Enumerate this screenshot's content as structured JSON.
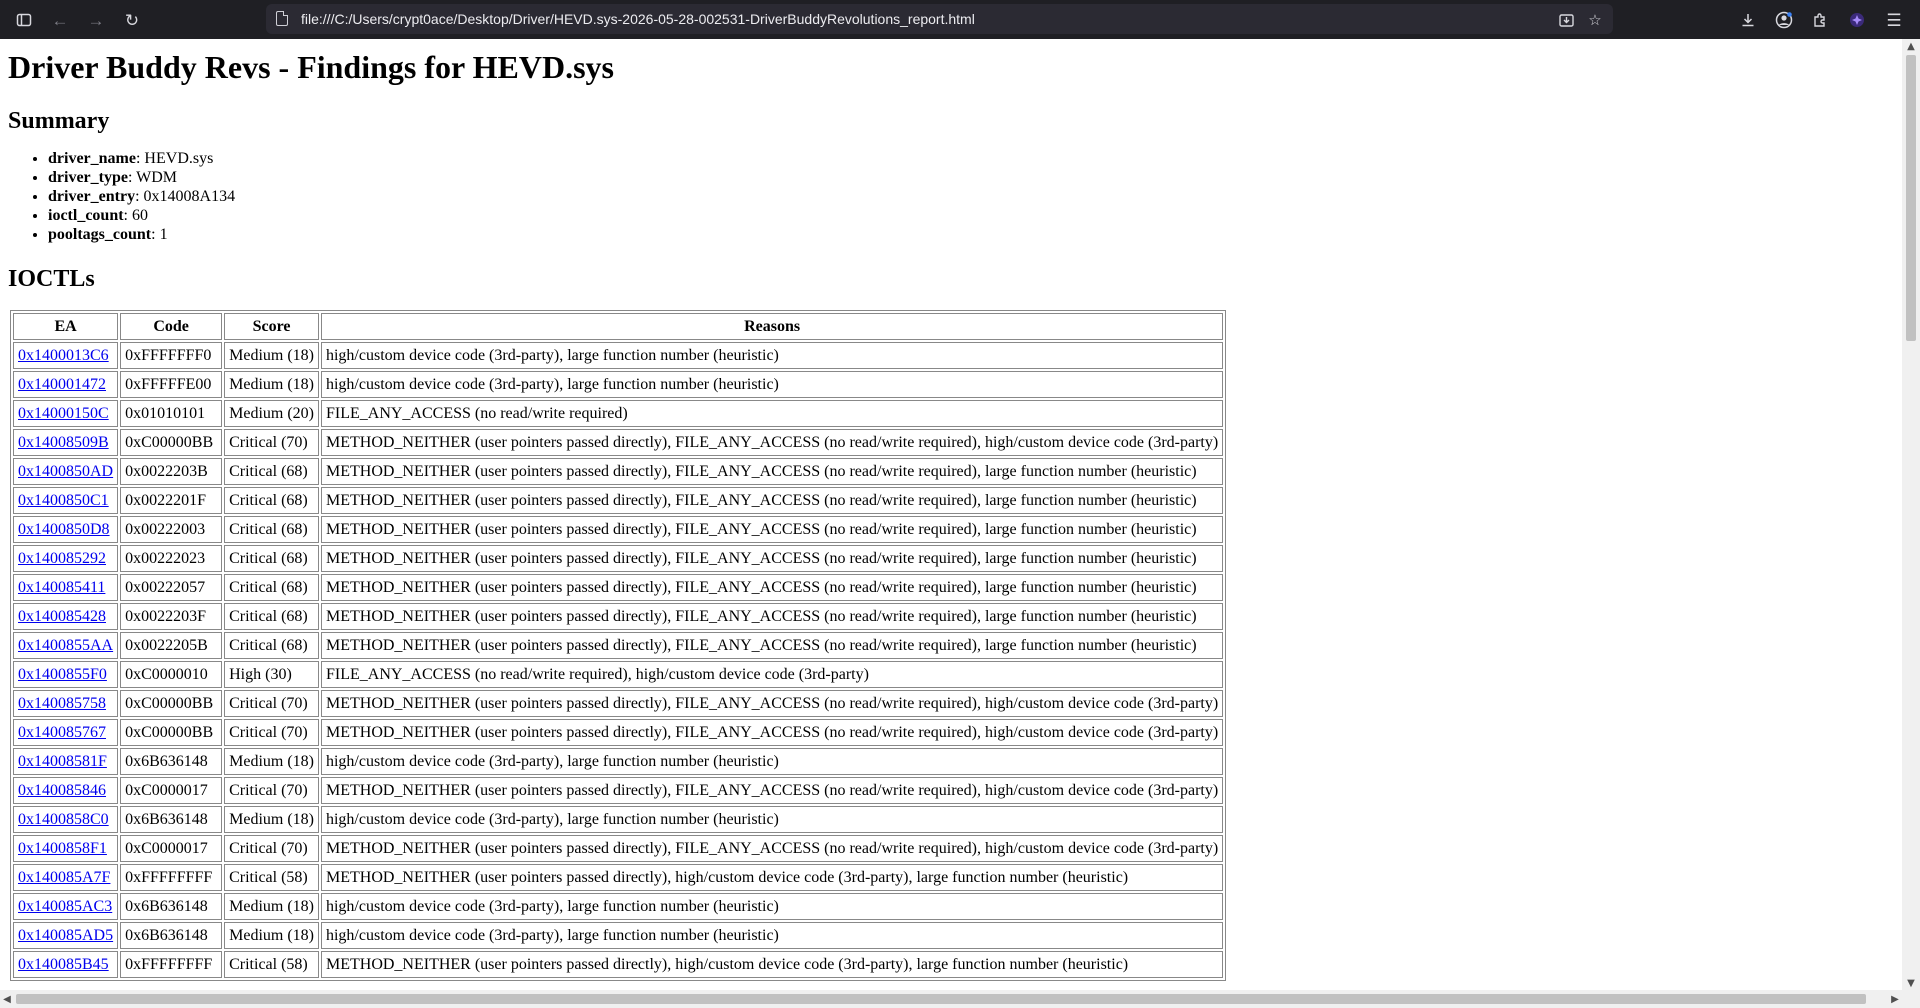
{
  "browser": {
    "url": "file:///C:/Users/crypt0ace/Desktop/Driver/HEVD.sys-2026-05-28-002531-DriverBuddyRevolutions_report.html"
  },
  "page": {
    "title": "Driver Buddy Revs - Findings for HEVD.sys",
    "summary_heading": "Summary",
    "summary": [
      {
        "key": "driver_name",
        "value": ": HEVD.sys"
      },
      {
        "key": "driver_type",
        "value": ": WDM"
      },
      {
        "key": "driver_entry",
        "value": ": 0x14008A134"
      },
      {
        "key": "ioctl_count",
        "value": ": 60"
      },
      {
        "key": "pooltags_count",
        "value": ": 1"
      }
    ],
    "ioctls_heading": "IOCTLs"
  },
  "table": {
    "headers": [
      "EA",
      "Code",
      "Score",
      "Reasons"
    ],
    "rows": [
      {
        "ea": "0x1400013C6",
        "code": "0xFFFFFFF0",
        "score": "Medium (18)",
        "reasons": "high/custom device code (3rd-party), large function number (heuristic)"
      },
      {
        "ea": "0x140001472",
        "code": "0xFFFFFE00",
        "score": "Medium (18)",
        "reasons": "high/custom device code (3rd-party), large function number (heuristic)"
      },
      {
        "ea": "0x14000150C",
        "code": "0x01010101",
        "score": "Medium (20)",
        "reasons": "FILE_ANY_ACCESS (no read/write required)"
      },
      {
        "ea": "0x14008509B",
        "code": "0xC00000BB",
        "score": "Critical (70)",
        "reasons": "METHOD_NEITHER (user pointers passed directly), FILE_ANY_ACCESS (no read/write required), high/custom device code (3rd-party)"
      },
      {
        "ea": "0x1400850AD",
        "code": "0x0022203B",
        "score": "Critical (68)",
        "reasons": "METHOD_NEITHER (user pointers passed directly), FILE_ANY_ACCESS (no read/write required), large function number (heuristic)"
      },
      {
        "ea": "0x1400850C1",
        "code": "0x0022201F",
        "score": "Critical (68)",
        "reasons": "METHOD_NEITHER (user pointers passed directly), FILE_ANY_ACCESS (no read/write required), large function number (heuristic)"
      },
      {
        "ea": "0x1400850D8",
        "code": "0x00222003",
        "score": "Critical (68)",
        "reasons": "METHOD_NEITHER (user pointers passed directly), FILE_ANY_ACCESS (no read/write required), large function number (heuristic)"
      },
      {
        "ea": "0x140085292",
        "code": "0x00222023",
        "score": "Critical (68)",
        "reasons": "METHOD_NEITHER (user pointers passed directly), FILE_ANY_ACCESS (no read/write required), large function number (heuristic)"
      },
      {
        "ea": "0x140085411",
        "code": "0x00222057",
        "score": "Critical (68)",
        "reasons": "METHOD_NEITHER (user pointers passed directly), FILE_ANY_ACCESS (no read/write required), large function number (heuristic)"
      },
      {
        "ea": "0x140085428",
        "code": "0x0022203F",
        "score": "Critical (68)",
        "reasons": "METHOD_NEITHER (user pointers passed directly), FILE_ANY_ACCESS (no read/write required), large function number (heuristic)"
      },
      {
        "ea": "0x1400855AA",
        "code": "0x0022205B",
        "score": "Critical (68)",
        "reasons": "METHOD_NEITHER (user pointers passed directly), FILE_ANY_ACCESS (no read/write required), large function number (heuristic)"
      },
      {
        "ea": "0x1400855F0",
        "code": "0xC0000010",
        "score": "High (30)",
        "reasons": "FILE_ANY_ACCESS (no read/write required), high/custom device code (3rd-party)"
      },
      {
        "ea": "0x140085758",
        "code": "0xC00000BB",
        "score": "Critical (70)",
        "reasons": "METHOD_NEITHER (user pointers passed directly), FILE_ANY_ACCESS (no read/write required), high/custom device code (3rd-party)"
      },
      {
        "ea": "0x140085767",
        "code": "0xC00000BB",
        "score": "Critical (70)",
        "reasons": "METHOD_NEITHER (user pointers passed directly), FILE_ANY_ACCESS (no read/write required), high/custom device code (3rd-party)"
      },
      {
        "ea": "0x14008581F",
        "code": "0x6B636148",
        "score": "Medium (18)",
        "reasons": "high/custom device code (3rd-party), large function number (heuristic)"
      },
      {
        "ea": "0x140085846",
        "code": "0xC0000017",
        "score": "Critical (70)",
        "reasons": "METHOD_NEITHER (user pointers passed directly), FILE_ANY_ACCESS (no read/write required), high/custom device code (3rd-party)"
      },
      {
        "ea": "0x1400858C0",
        "code": "0x6B636148",
        "score": "Medium (18)",
        "reasons": "high/custom device code (3rd-party), large function number (heuristic)"
      },
      {
        "ea": "0x1400858F1",
        "code": "0xC0000017",
        "score": "Critical (70)",
        "reasons": "METHOD_NEITHER (user pointers passed directly), FILE_ANY_ACCESS (no read/write required), high/custom device code (3rd-party)"
      },
      {
        "ea": "0x140085A7F",
        "code": "0xFFFFFFFF",
        "score": "Critical (58)",
        "reasons": "METHOD_NEITHER (user pointers passed directly), high/custom device code (3rd-party), large function number (heuristic)"
      },
      {
        "ea": "0x140085AC3",
        "code": "0x6B636148",
        "score": "Medium (18)",
        "reasons": "high/custom device code (3rd-party), large function number (heuristic)"
      },
      {
        "ea": "0x140085AD5",
        "code": "0x6B636148",
        "score": "Medium (18)",
        "reasons": "high/custom device code (3rd-party), large function number (heuristic)"
      },
      {
        "ea": "0x140085B45",
        "code": "0xFFFFFFFF",
        "score": "Critical (58)",
        "reasons": "METHOD_NEITHER (user pointers passed directly), high/custom device code (3rd-party), large function number (heuristic)"
      }
    ]
  }
}
